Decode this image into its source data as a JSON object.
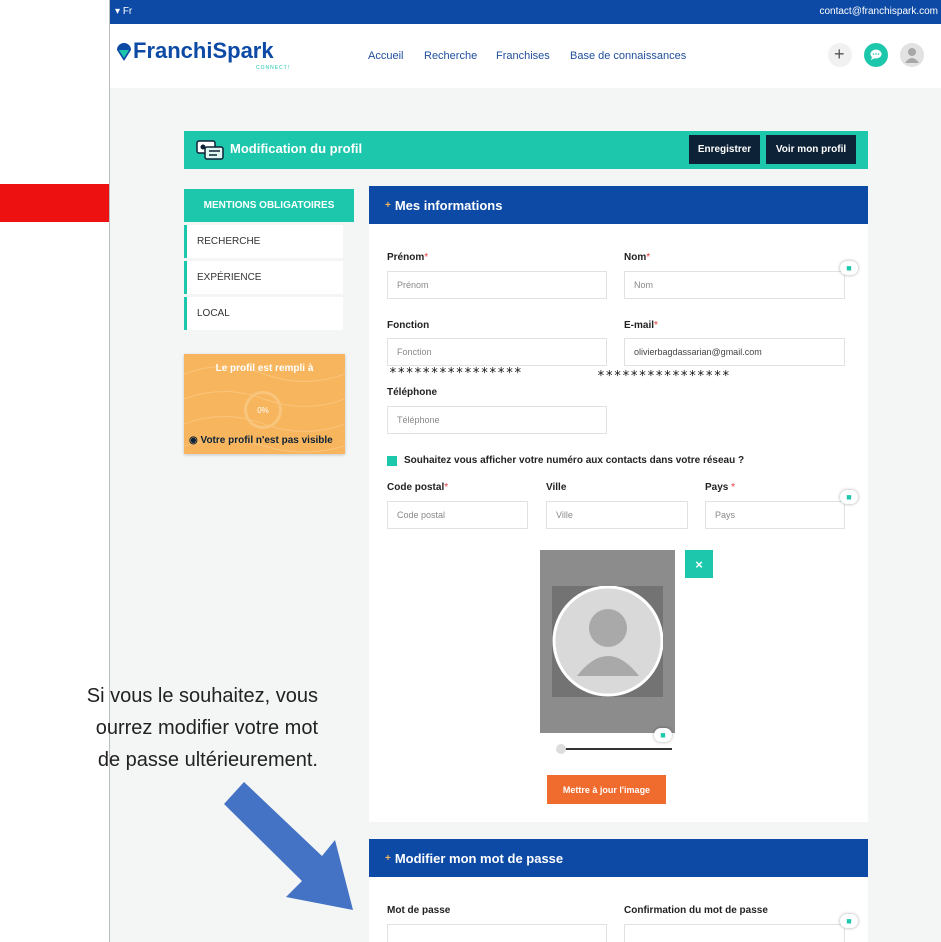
{
  "topbar": {
    "language": "Fr",
    "contact_email": "contact@franchispark.com"
  },
  "brand": {
    "logo_text": "FranchiSpark",
    "logo_subtext": "CONNECT!"
  },
  "nav": {
    "links": [
      "Accueil",
      "Recherche",
      "Franchises",
      "Base de connaissances"
    ]
  },
  "header": {
    "title": "Modification du profil",
    "save_label": "Enregistrer",
    "view_label": "Voir mon profil"
  },
  "sidebar": {
    "items": [
      {
        "label": "MENTIONS OBLIGATOIRES",
        "active": true
      },
      {
        "label": "RECHERCHE"
      },
      {
        "label": "EXPÉRIENCE"
      },
      {
        "label": "LOCAL"
      }
    ]
  },
  "completion": {
    "title": "Le profil est rempli à",
    "percent_text": "0%",
    "percent": 0,
    "visibility": "Votre profil n'est pas visible"
  },
  "info": {
    "title": "Mes informations",
    "prenom": {
      "label": "Prénom",
      "placeholder": "Prénom"
    },
    "nom": {
      "label": "Nom",
      "placeholder": "Nom"
    },
    "fonction": {
      "label": "Fonction",
      "placeholder": "Fonction"
    },
    "email": {
      "label": "E-mail",
      "value": "olivierbagdassarian@gmail.com"
    },
    "masked_left": "****************",
    "masked_right": "****************",
    "telephone": {
      "label": "Téléphone",
      "placeholder": "Téléphone"
    },
    "show_phone": {
      "label": "Souhaitez vous afficher votre numéro aux contacts dans votre réseau ?",
      "checked": true
    },
    "code_postal": {
      "label": "Code postal",
      "placeholder": "Code postal"
    },
    "ville": {
      "label": "Ville",
      "placeholder": "Ville"
    },
    "pays": {
      "label": "Pays",
      "placeholder": "Pays"
    },
    "remove_image": "×",
    "update_image": "Mettre à jour l'image"
  },
  "password": {
    "title": "Modifier mon mot de passe",
    "password_label": "Mot de passe",
    "confirm_label": "Confirmation du mot de passe"
  },
  "annotation": {
    "lines": [
      "Si vous le souhaitez, vous",
      "ourrez modifier votre mot",
      "de passe ultérieurement."
    ]
  },
  "colors": {
    "primary_blue": "#0d4aa6",
    "teal": "#1cc7ac",
    "dark_button": "#0d2237",
    "orange": "#ef6b2e",
    "arrow_red": "#ee1111",
    "arrow_blue": "#4472c4",
    "card_orange": "#f7b55d"
  }
}
